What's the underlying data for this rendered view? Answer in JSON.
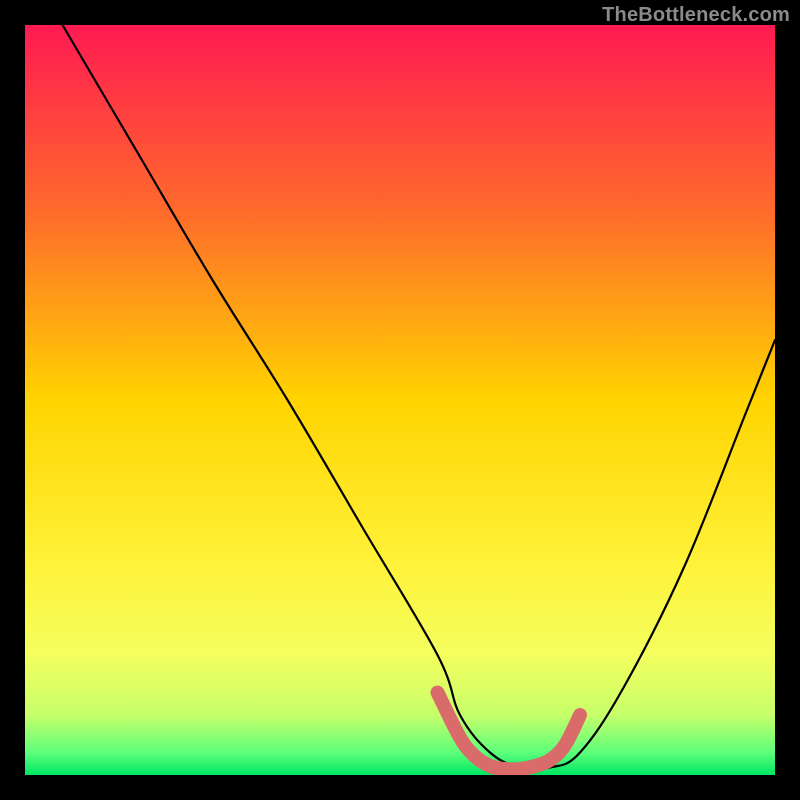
{
  "watermark": "TheBottleneck.com",
  "chart_data": {
    "type": "line",
    "title": "",
    "xlabel": "",
    "ylabel": "",
    "xlim": [
      0,
      100
    ],
    "ylim": [
      0,
      100
    ],
    "grid": false,
    "legend": false,
    "gradient_stops": [
      {
        "offset": 0,
        "color": "#ff1a52"
      },
      {
        "offset": 0.25,
        "color": "#ff6b2b"
      },
      {
        "offset": 0.5,
        "color": "#ffd400"
      },
      {
        "offset": 0.72,
        "color": "#fff23a"
      },
      {
        "offset": 0.84,
        "color": "#f4ff5e"
      },
      {
        "offset": 0.92,
        "color": "#c6ff6a"
      },
      {
        "offset": 0.97,
        "color": "#5dff7a"
      },
      {
        "offset": 1.0,
        "color": "#00e663"
      }
    ],
    "series": [
      {
        "name": "bottleneck-curve",
        "x": [
          5,
          15,
          25,
          35,
          45,
          55,
          58,
          62,
          66,
          70,
          74,
          80,
          88,
          96,
          100
        ],
        "y": [
          100,
          83,
          66,
          50,
          33,
          16,
          8,
          3,
          1,
          1,
          3,
          12,
          28,
          48,
          58
        ]
      }
    ],
    "highlight_segment": {
      "name": "optimal-range",
      "color": "#d96b6b",
      "x": [
        55,
        58,
        60,
        62,
        64,
        66,
        68,
        70,
        72,
        74
      ],
      "y": [
        11,
        5,
        2.5,
        1.2,
        0.8,
        0.8,
        1.2,
        2,
        4,
        8
      ]
    }
  }
}
